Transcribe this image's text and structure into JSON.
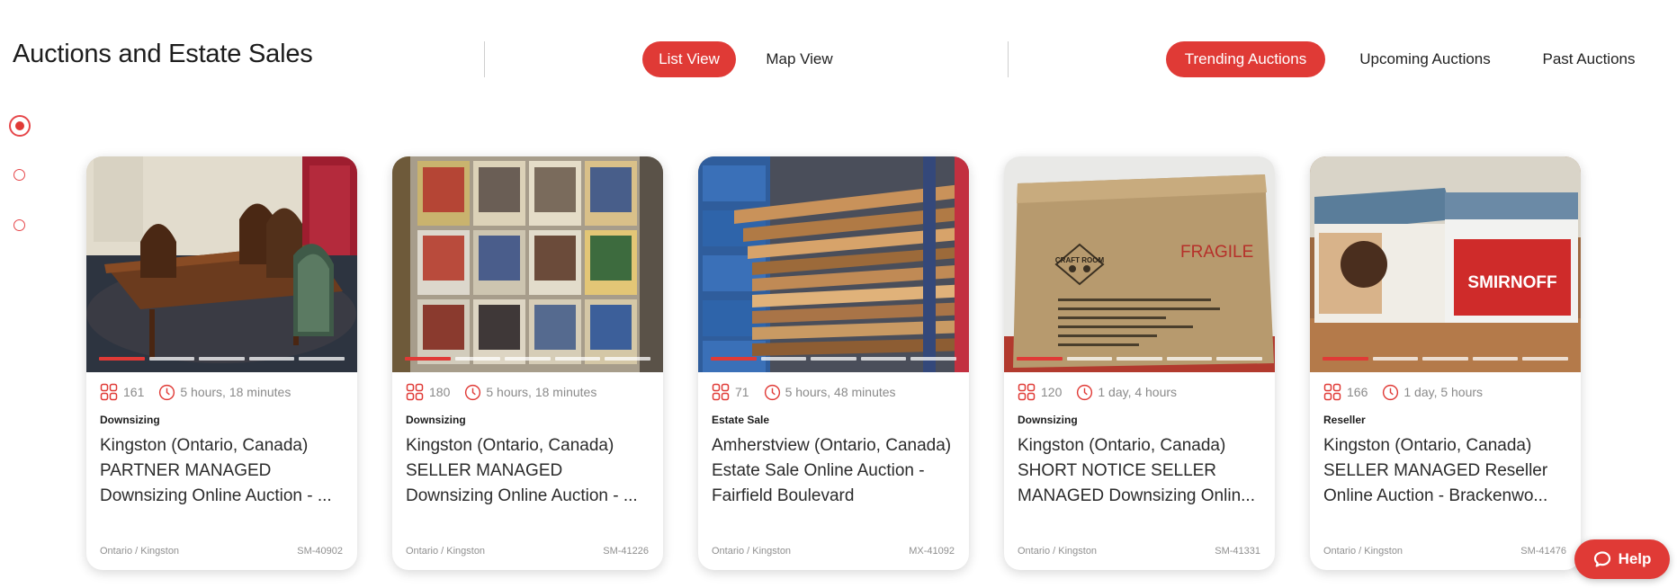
{
  "header": {
    "title": "Auctions and Estate Sales",
    "view_tabs": [
      {
        "label": "List View",
        "active": true
      },
      {
        "label": "Map View",
        "active": false
      }
    ],
    "filter_tabs": [
      {
        "label": "Trending Auctions",
        "active": true
      },
      {
        "label": "Upcoming Auctions",
        "active": false
      },
      {
        "label": "Past Auctions",
        "active": false
      }
    ]
  },
  "pager_dots": {
    "count": 3,
    "active_index": 0
  },
  "accent_color": "#e03a36",
  "cards": [
    {
      "lots": "161",
      "time_left": "5 hours, 18 minutes",
      "category": "Downsizing",
      "title": "Kingston (Ontario, Canada) PARTNER MANAGED Downsizing Online Auction - ...",
      "location": "Ontario / Kingston",
      "code": "SM-40902",
      "image": "dining-table-photo"
    },
    {
      "lots": "180",
      "time_left": "5 hours, 18 minutes",
      "category": "Downsizing",
      "title": "Kingston (Ontario, Canada) SELLER MANAGED Downsizing Online Auction - ...",
      "location": "Ontario / Kingston",
      "code": "SM-41226",
      "image": "hockey-cards-photo"
    },
    {
      "lots": "71",
      "time_left": "5 hours, 48 minutes",
      "category": "Estate Sale",
      "title": "Amherstview (Ontario, Canada) Estate Sale Online Auction - Fairfield Boulevard",
      "location": "Ontario / Kingston",
      "code": "MX-41092",
      "image": "lumber-shelves-photo"
    },
    {
      "lots": "120",
      "time_left": "1 day, 4 hours",
      "category": "Downsizing",
      "title": "Kingston (Ontario, Canada) SHORT NOTICE SELLER MANAGED Downsizing Onlin...",
      "location": "Ontario / Kingston",
      "code": "SM-41331",
      "image": "cardboard-box-photo",
      "box_text": {
        "fragile": "FRAGILE",
        "brand": "CRAFT ROOM"
      }
    },
    {
      "lots": "166",
      "time_left": "1 day, 5 hours",
      "category": "Reseller",
      "title": "Kingston (Ontario, Canada) SELLER MANAGED Reseller Online Auction - Brackenwo...",
      "location": "Ontario / Kingston",
      "code": "SM-41476",
      "image": "vinyl-records-photo",
      "box_text": {
        "brand": "SMIRNOFF"
      }
    }
  ],
  "help": {
    "label": "Help"
  }
}
